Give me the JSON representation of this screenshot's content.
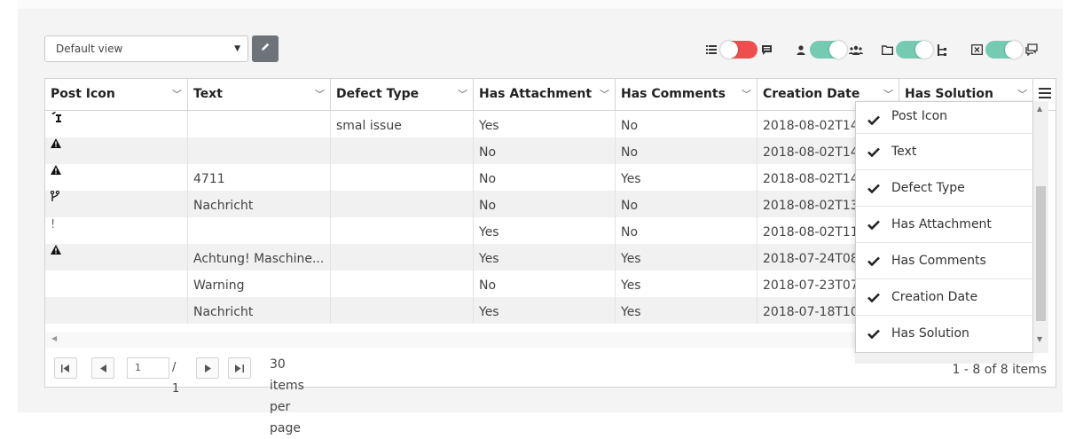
{
  "toolbar": {
    "view_select_value": "Default view",
    "toggles": [
      {
        "left_icon": "list-icon",
        "right_icon": "message-icon",
        "state": "off",
        "color": "#ef4e4e"
      },
      {
        "left_icon": "user-icon",
        "right_icon": "users-icon",
        "state": "on",
        "color": "#74cbb2"
      },
      {
        "left_icon": "folder-icon",
        "right_icon": "tree-icon",
        "state": "on",
        "color": "#74cbb2"
      },
      {
        "left_icon": "close-box-icon",
        "right_icon": "comments-icon",
        "state": "on",
        "color": "#74cbb2"
      }
    ]
  },
  "grid": {
    "columns": [
      "Post Icon",
      "Text",
      "Defect Type",
      "Has Attachment",
      "Has Comments",
      "Creation Date",
      "Has Solution"
    ],
    "rows": [
      {
        "icon": "hammer-icon",
        "text": "",
        "defect_type": "smal issue",
        "has_attachment": "Yes",
        "has_comments": "No",
        "creation_date": "2018-08-02T14"
      },
      {
        "icon": "warning-icon",
        "text": "",
        "defect_type": "",
        "has_attachment": "No",
        "has_comments": "No",
        "creation_date": "2018-08-02T14"
      },
      {
        "icon": "warning-icon",
        "text": "4711",
        "defect_type": "",
        "has_attachment": "No",
        "has_comments": "Yes",
        "creation_date": "2018-08-02T14"
      },
      {
        "icon": "branch-icon",
        "text": "Nachricht",
        "defect_type": "",
        "has_attachment": "No",
        "has_comments": "No",
        "creation_date": "2018-08-02T13"
      },
      {
        "icon": "exclamation-icon",
        "text": "",
        "defect_type": "",
        "has_attachment": "Yes",
        "has_comments": "No",
        "creation_date": "2018-08-02T11"
      },
      {
        "icon": "warning-icon",
        "text": "Achtung! Maschine...",
        "defect_type": "",
        "has_attachment": "Yes",
        "has_comments": "Yes",
        "creation_date": "2018-07-24T08"
      },
      {
        "icon": "",
        "text": "Warning",
        "defect_type": "",
        "has_attachment": "No",
        "has_comments": "Yes",
        "creation_date": "2018-07-23T07"
      },
      {
        "icon": "",
        "text": "Nachricht",
        "defect_type": "",
        "has_attachment": "Yes",
        "has_comments": "Yes",
        "creation_date": "2018-07-18T10"
      }
    ]
  },
  "pager": {
    "current_page": "1",
    "total_pages": "/ 1",
    "per_page_label": "30 items per page",
    "items_count": "1 - 8 of 8 items"
  },
  "column_menu": {
    "items": [
      "Post Icon",
      "Text",
      "Defect Type",
      "Has Attachment",
      "Has Comments",
      "Creation Date",
      "Has Solution"
    ]
  }
}
